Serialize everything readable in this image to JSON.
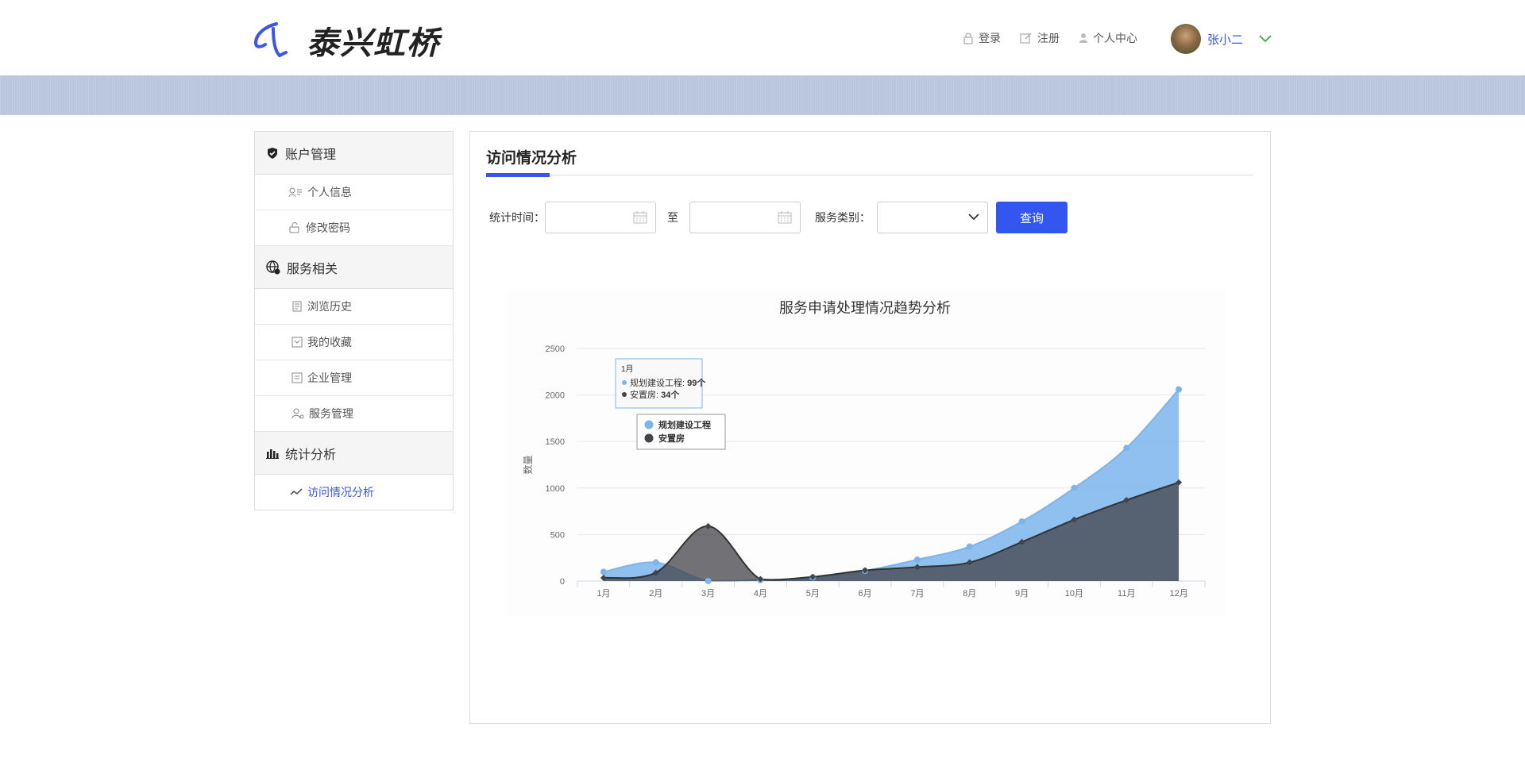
{
  "brand": {
    "name": "泰兴虹桥"
  },
  "topnav": {
    "login": "登录",
    "register": "注册",
    "profile": "个人中心"
  },
  "user": {
    "name": "张小二"
  },
  "sidebar": {
    "groups": [
      {
        "label": "账户管理",
        "items": [
          {
            "label": "个人信息"
          },
          {
            "label": "修改密码"
          }
        ]
      },
      {
        "label": "服务相关",
        "items": [
          {
            "label": "浏览历史"
          },
          {
            "label": "我的收藏"
          },
          {
            "label": "企业管理"
          },
          {
            "label": "服务管理"
          }
        ]
      },
      {
        "label": "统计分析",
        "items": [
          {
            "label": "访问情况分析"
          }
        ]
      }
    ]
  },
  "main": {
    "title": "访问情况分析",
    "filters": {
      "time_label": "统计时间：",
      "to_label": "至",
      "category_label": "服务类别：",
      "query_button": "查询"
    }
  },
  "colors": {
    "accent": "#3a55e8",
    "series1": "#7cb5ec",
    "series2": "#434348"
  },
  "tooltip": {
    "title": "1月",
    "s1_label": "规划建设工程: ",
    "s1_value": "99个",
    "s2_label": "安置房: ",
    "s2_value": "34个"
  },
  "chart_data": {
    "type": "area",
    "title": "服务申请处理情况趋势分析",
    "ylabel": "数量",
    "xlabel": "",
    "categories": [
      "1月",
      "2月",
      "3月",
      "4月",
      "5月",
      "6月",
      "7月",
      "8月",
      "9月",
      "10月",
      "11月",
      "12月"
    ],
    "ylim": [
      0,
      2500
    ],
    "yticks": [
      0,
      500,
      1000,
      1500,
      2000,
      2500
    ],
    "grid": true,
    "legend": "top-left",
    "series": [
      {
        "name": "规划建设工程",
        "values": [
          99,
          200,
          0,
          10,
          40,
          110,
          230,
          370,
          640,
          1000,
          1430,
          2060
        ]
      },
      {
        "name": "安置房",
        "values": [
          34,
          90,
          590,
          20,
          45,
          115,
          150,
          200,
          420,
          660,
          870,
          1060
        ]
      }
    ]
  }
}
